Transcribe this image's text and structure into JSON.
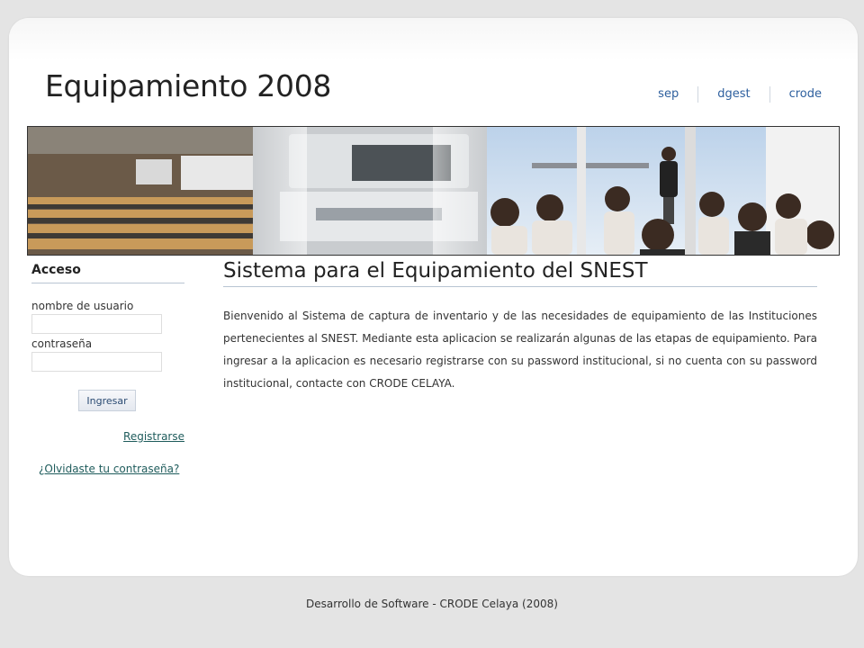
{
  "header": {
    "title": "Equipamiento 2008",
    "links": [
      "sep",
      "dgest",
      "crode"
    ]
  },
  "banner": {
    "image": "classroom-and-lab-banner"
  },
  "sidebar": {
    "heading": "Acceso",
    "username_label": "nombre de usuario",
    "username_value": "",
    "password_label": "contraseña",
    "password_value": "",
    "submit_label": "Ingresar",
    "register_link": "Registrarse",
    "forgot_link": "¿Olvidaste tu contraseña?"
  },
  "main": {
    "title": "Sistema para el Equipamiento del SNEST",
    "body": "Bienvenido al Sistema de captura de inventario y de las necesidades de equipamiento de las Instituciones pertenecientes al SNEST. Mediante esta aplicacion se realizarán algunas de las etapas de equipamiento. Para ingresar a la aplicacion es necesario registrarse con su password institucional, si no cuenta con su password institucional, contacte con CRODE CELAYA."
  },
  "footer": {
    "text": "Desarrollo de Software - CRODE Celaya (2008)"
  },
  "colors": {
    "link": "#2d5f9e",
    "rule": "#b8c4d2",
    "page_bg": "#e4e4e4"
  }
}
